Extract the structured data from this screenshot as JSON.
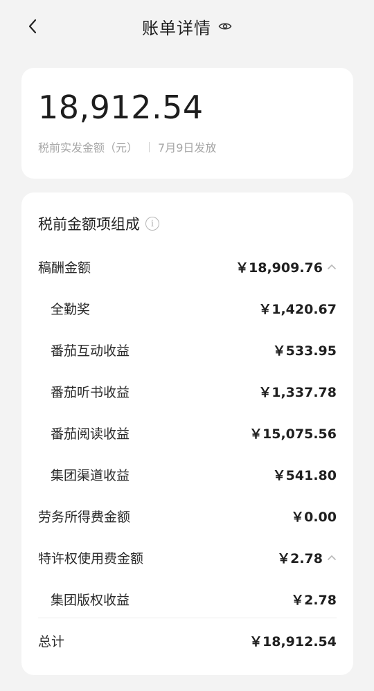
{
  "header": {
    "title": "账单详情"
  },
  "summary": {
    "amount": "18,912.54",
    "amount_label": "税前实发金额（元）",
    "date": "7月9日发放"
  },
  "detail": {
    "title": "税前金额项组成",
    "rows": [
      {
        "label": "稿酬金额",
        "value": "￥18,909.76",
        "expanded": true
      },
      {
        "label": "全勤奖",
        "value": "￥1,420.67"
      },
      {
        "label": "番茄互动收益",
        "value": "￥533.95"
      },
      {
        "label": "番茄听书收益",
        "value": "￥1,337.78"
      },
      {
        "label": "番茄阅读收益",
        "value": "￥15,075.56"
      },
      {
        "label": "集团渠道收益",
        "value": "￥541.80"
      },
      {
        "label": "劳务所得费金额",
        "value": "￥0.00"
      },
      {
        "label": "特许权使用费金额",
        "value": "￥2.78",
        "expanded": true
      },
      {
        "label": "集团版权收益",
        "value": "￥2.78"
      }
    ],
    "total": {
      "label": "总计",
      "value": "￥18,912.54"
    }
  }
}
